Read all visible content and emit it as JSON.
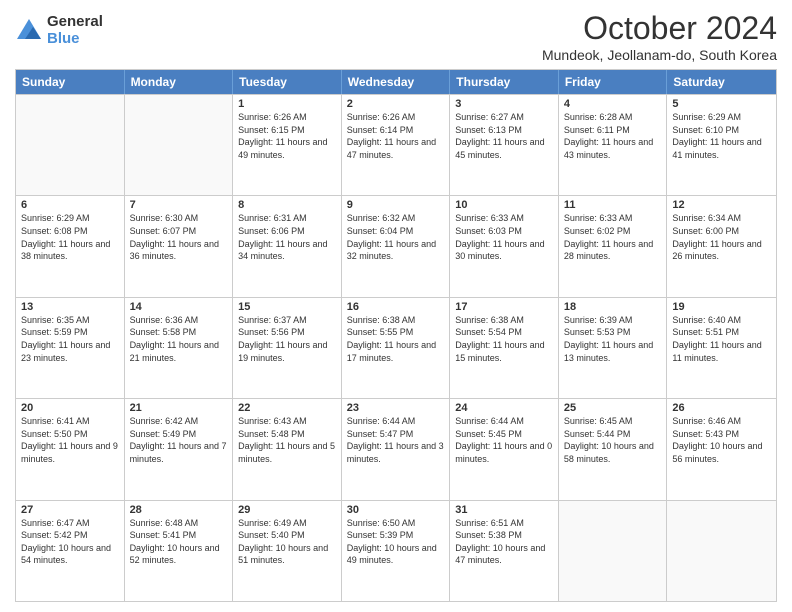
{
  "logo": {
    "general": "General",
    "blue": "Blue"
  },
  "title": "October 2024",
  "subtitle": "Mundeok, Jeollanam-do, South Korea",
  "header": {
    "days": [
      "Sunday",
      "Monday",
      "Tuesday",
      "Wednesday",
      "Thursday",
      "Friday",
      "Saturday"
    ]
  },
  "weeks": [
    [
      {
        "day": "",
        "info": ""
      },
      {
        "day": "",
        "info": ""
      },
      {
        "day": "1",
        "info": "Sunrise: 6:26 AM\nSunset: 6:15 PM\nDaylight: 11 hours and 49 minutes."
      },
      {
        "day": "2",
        "info": "Sunrise: 6:26 AM\nSunset: 6:14 PM\nDaylight: 11 hours and 47 minutes."
      },
      {
        "day": "3",
        "info": "Sunrise: 6:27 AM\nSunset: 6:13 PM\nDaylight: 11 hours and 45 minutes."
      },
      {
        "day": "4",
        "info": "Sunrise: 6:28 AM\nSunset: 6:11 PM\nDaylight: 11 hours and 43 minutes."
      },
      {
        "day": "5",
        "info": "Sunrise: 6:29 AM\nSunset: 6:10 PM\nDaylight: 11 hours and 41 minutes."
      }
    ],
    [
      {
        "day": "6",
        "info": "Sunrise: 6:29 AM\nSunset: 6:08 PM\nDaylight: 11 hours and 38 minutes."
      },
      {
        "day": "7",
        "info": "Sunrise: 6:30 AM\nSunset: 6:07 PM\nDaylight: 11 hours and 36 minutes."
      },
      {
        "day": "8",
        "info": "Sunrise: 6:31 AM\nSunset: 6:06 PM\nDaylight: 11 hours and 34 minutes."
      },
      {
        "day": "9",
        "info": "Sunrise: 6:32 AM\nSunset: 6:04 PM\nDaylight: 11 hours and 32 minutes."
      },
      {
        "day": "10",
        "info": "Sunrise: 6:33 AM\nSunset: 6:03 PM\nDaylight: 11 hours and 30 minutes."
      },
      {
        "day": "11",
        "info": "Sunrise: 6:33 AM\nSunset: 6:02 PM\nDaylight: 11 hours and 28 minutes."
      },
      {
        "day": "12",
        "info": "Sunrise: 6:34 AM\nSunset: 6:00 PM\nDaylight: 11 hours and 26 minutes."
      }
    ],
    [
      {
        "day": "13",
        "info": "Sunrise: 6:35 AM\nSunset: 5:59 PM\nDaylight: 11 hours and 23 minutes."
      },
      {
        "day": "14",
        "info": "Sunrise: 6:36 AM\nSunset: 5:58 PM\nDaylight: 11 hours and 21 minutes."
      },
      {
        "day": "15",
        "info": "Sunrise: 6:37 AM\nSunset: 5:56 PM\nDaylight: 11 hours and 19 minutes."
      },
      {
        "day": "16",
        "info": "Sunrise: 6:38 AM\nSunset: 5:55 PM\nDaylight: 11 hours and 17 minutes."
      },
      {
        "day": "17",
        "info": "Sunrise: 6:38 AM\nSunset: 5:54 PM\nDaylight: 11 hours and 15 minutes."
      },
      {
        "day": "18",
        "info": "Sunrise: 6:39 AM\nSunset: 5:53 PM\nDaylight: 11 hours and 13 minutes."
      },
      {
        "day": "19",
        "info": "Sunrise: 6:40 AM\nSunset: 5:51 PM\nDaylight: 11 hours and 11 minutes."
      }
    ],
    [
      {
        "day": "20",
        "info": "Sunrise: 6:41 AM\nSunset: 5:50 PM\nDaylight: 11 hours and 9 minutes."
      },
      {
        "day": "21",
        "info": "Sunrise: 6:42 AM\nSunset: 5:49 PM\nDaylight: 11 hours and 7 minutes."
      },
      {
        "day": "22",
        "info": "Sunrise: 6:43 AM\nSunset: 5:48 PM\nDaylight: 11 hours and 5 minutes."
      },
      {
        "day": "23",
        "info": "Sunrise: 6:44 AM\nSunset: 5:47 PM\nDaylight: 11 hours and 3 minutes."
      },
      {
        "day": "24",
        "info": "Sunrise: 6:44 AM\nSunset: 5:45 PM\nDaylight: 11 hours and 0 minutes."
      },
      {
        "day": "25",
        "info": "Sunrise: 6:45 AM\nSunset: 5:44 PM\nDaylight: 10 hours and 58 minutes."
      },
      {
        "day": "26",
        "info": "Sunrise: 6:46 AM\nSunset: 5:43 PM\nDaylight: 10 hours and 56 minutes."
      }
    ],
    [
      {
        "day": "27",
        "info": "Sunrise: 6:47 AM\nSunset: 5:42 PM\nDaylight: 10 hours and 54 minutes."
      },
      {
        "day": "28",
        "info": "Sunrise: 6:48 AM\nSunset: 5:41 PM\nDaylight: 10 hours and 52 minutes."
      },
      {
        "day": "29",
        "info": "Sunrise: 6:49 AM\nSunset: 5:40 PM\nDaylight: 10 hours and 51 minutes."
      },
      {
        "day": "30",
        "info": "Sunrise: 6:50 AM\nSunset: 5:39 PM\nDaylight: 10 hours and 49 minutes."
      },
      {
        "day": "31",
        "info": "Sunrise: 6:51 AM\nSunset: 5:38 PM\nDaylight: 10 hours and 47 minutes."
      },
      {
        "day": "",
        "info": ""
      },
      {
        "day": "",
        "info": ""
      }
    ]
  ]
}
